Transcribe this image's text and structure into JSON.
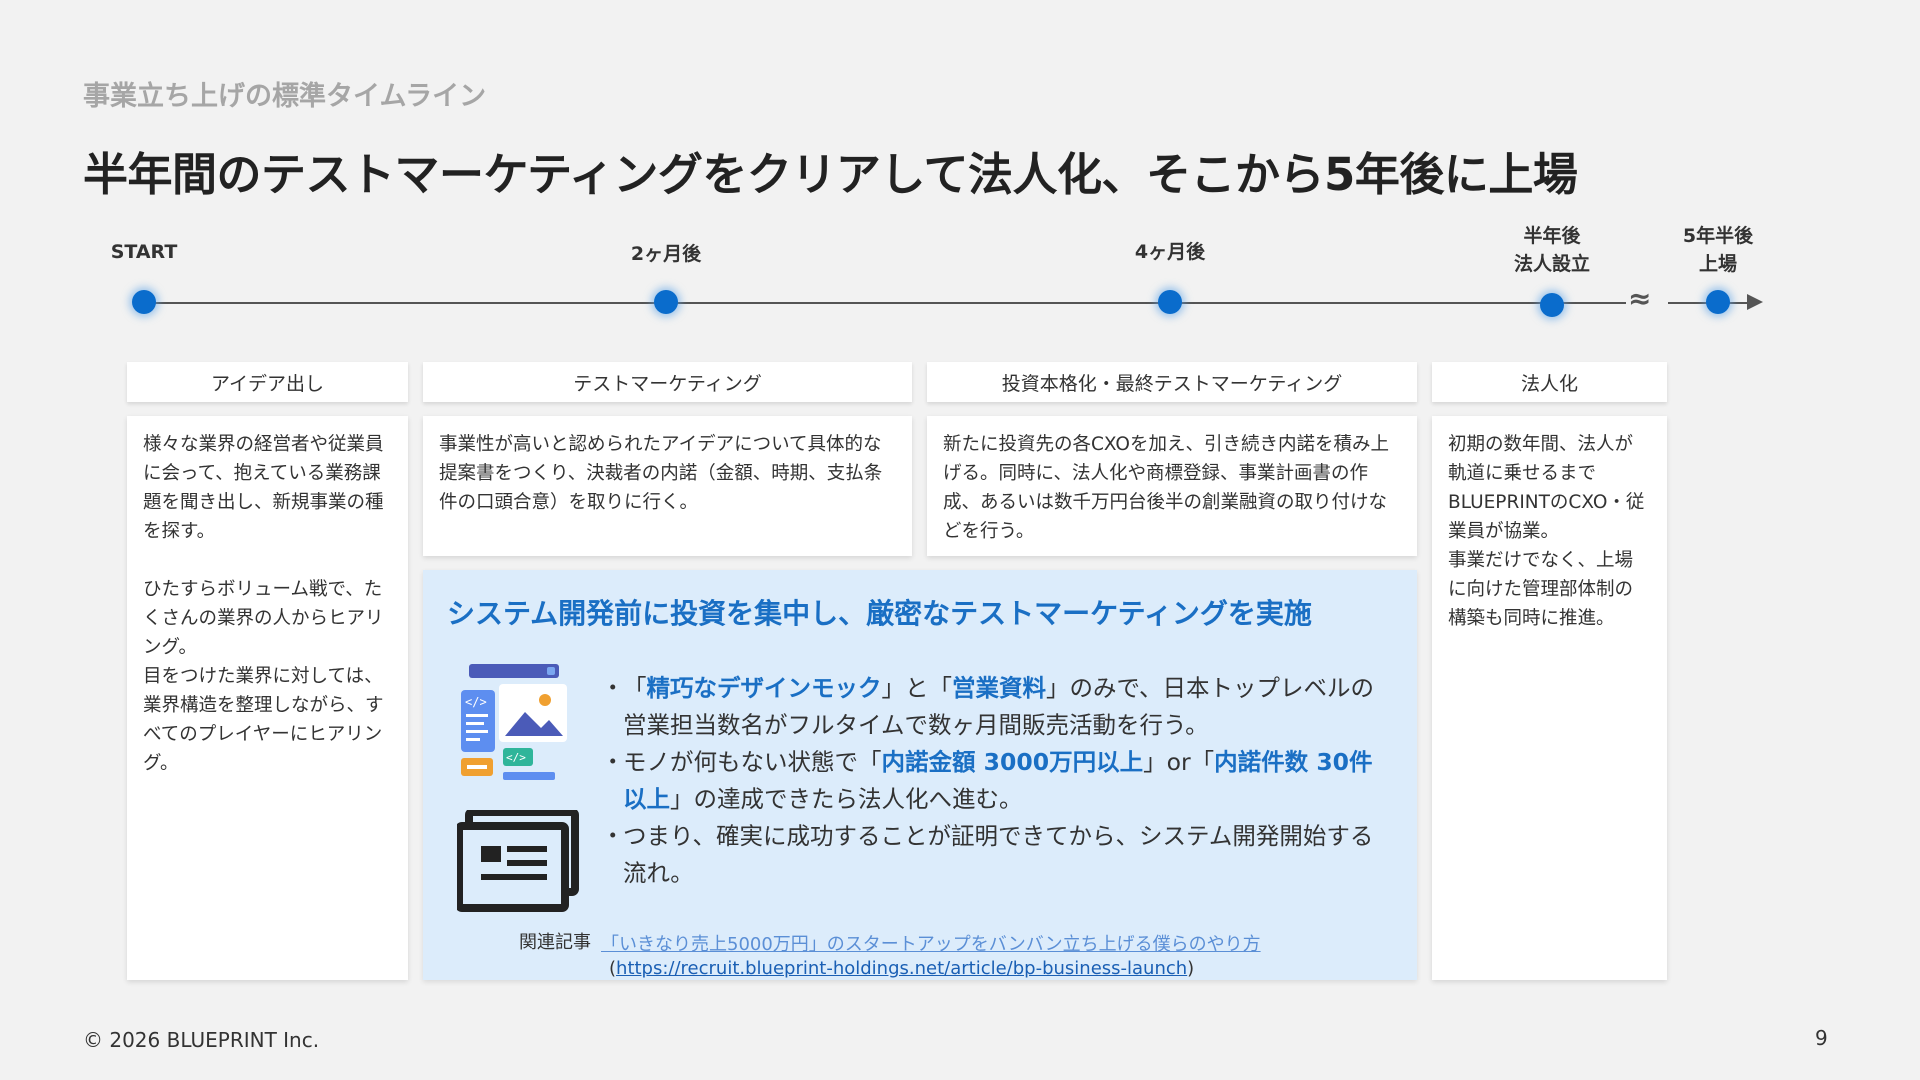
{
  "header": {
    "subtitle": "事業立ち上げの標準タイムライン",
    "title": "半年間のテストマーケティングをクリアして法人化、そこから5年後に上場"
  },
  "timeline": {
    "milestones": [
      {
        "line1": "START",
        "line2": ""
      },
      {
        "line1": "2ヶ月後",
        "line2": ""
      },
      {
        "line1": "4ヶ月後",
        "line2": ""
      },
      {
        "line1": "半年後",
        "line2": "法人設立"
      },
      {
        "line1": "5年半後",
        "line2": "上場"
      }
    ],
    "break_symbol": "≈"
  },
  "phases": [
    {
      "title": "アイデア出し",
      "body": "様々な業界の経営者や従業員に会って、抱えている業務課題を聞き出し、新規事業の種を探す。\n\nひたすらボリューム戦で、たくさんの業界の人からヒアリング。\n目をつけた業界に対しては、業界構造を整理しながら、すべてのプレイヤーにヒアリング。"
    },
    {
      "title": "テストマーケティング",
      "body": "事業性が高いと認められたアイデアについて具体的な提案書をつくり、決裁者の内諾（金額、時期、支払条件の口頭合意）を取りに行く。"
    },
    {
      "title": "投資本格化・最終テストマーケティング",
      "body": "新たに投資先の各CXOを加え、引き続き内諾を積み上げる。同時に、法人化や商標登録、事業計画書の作成、あるいは数千万円台後半の創業融資の取り付けなどを行う。"
    },
    {
      "title": "法人化",
      "body": "初期の数年間、法人が軌道に乗せるまでBLUEPRINTのCXO・従業員が協業。\n事業だけでなく、上場に向けた管理部体制の構築も同時に推進。"
    }
  ],
  "highlight": {
    "title": "システム開発前に投資を集中し、厳密なテストマーケティングを実施",
    "bullet_marker": "・",
    "bullet1": {
      "q1_open": "「",
      "em1": "精巧なデザインモック",
      "mid": "」と「",
      "em2": "営業資料",
      "rest": "」のみで、日本トップレベルの営業担当数名がフルタイムで数ヶ月間販売活動を行う。"
    },
    "bullet2": {
      "pre": "モノが何もない状態で「",
      "em1": "内諾金額 3000万円以上",
      "mid": "」or「",
      "em2": "内諾件数 30件以上",
      "rest": "」の達成できたら法人化へ進む。"
    },
    "bullet3": "つまり、確実に成功することが証明できてから、システム開発開始する流れ。",
    "related_label": "関連記事",
    "related_title": "「いきなり売上5000万円」のスタートアップをバンバン立ち上げる僕らのやり方",
    "related_url_open": "(",
    "related_url": "https://recruit.blueprint-holdings.net/article/bp-business-launch",
    "related_url_close": ")",
    "icons": [
      "design-mockup-icon",
      "document-stack-icon"
    ]
  },
  "footer": {
    "copyright": "© 2026 BLUEPRINT Inc.",
    "page_number": "9"
  },
  "colors": {
    "accent_blue": "#1a6fc4",
    "dot_blue": "#0a6ccc",
    "highlight_bg": "#dcecfb",
    "background": "#f2f2f2"
  }
}
